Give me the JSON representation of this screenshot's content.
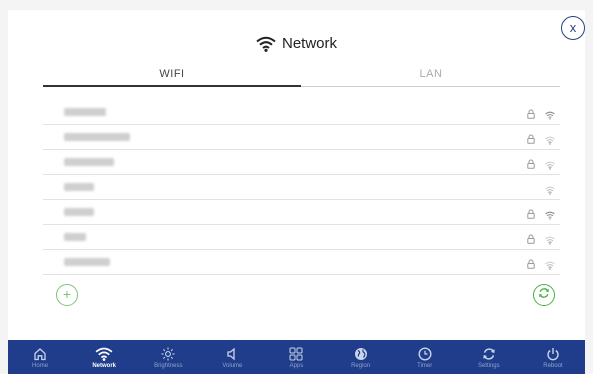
{
  "header": {
    "title": "Network",
    "close_label": "x"
  },
  "tabs": [
    {
      "label": "WIFI",
      "active": true
    },
    {
      "label": "LAN",
      "active": false
    }
  ],
  "networks": [
    {
      "ssid_redacted": true,
      "secured": true,
      "signal": "strong"
    },
    {
      "ssid_redacted": true,
      "secured": true,
      "signal": "weak"
    },
    {
      "ssid_redacted": true,
      "secured": true,
      "signal": "weak"
    },
    {
      "ssid_redacted": true,
      "secured": false,
      "signal": "weak"
    },
    {
      "ssid_redacted": true,
      "secured": true,
      "signal": "strong"
    },
    {
      "ssid_redacted": true,
      "secured": true,
      "signal": "weak"
    },
    {
      "ssid_redacted": true,
      "secured": true,
      "signal": "weak"
    }
  ],
  "actions": {
    "add_label": "+"
  },
  "nav": [
    {
      "label": "Home",
      "icon": "home-icon",
      "active": false
    },
    {
      "label": "Network",
      "icon": "wifi-icon",
      "active": true
    },
    {
      "label": "Brightness",
      "icon": "sun-icon",
      "active": false
    },
    {
      "label": "Volume",
      "icon": "speaker-icon",
      "active": false
    },
    {
      "label": "Apps",
      "icon": "apps-grid-icon",
      "active": false
    },
    {
      "label": "Region",
      "icon": "globe-icon",
      "active": false
    },
    {
      "label": "Timer",
      "icon": "clock-icon",
      "active": false
    },
    {
      "label": "Settings",
      "icon": "refresh-icon",
      "active": false
    },
    {
      "label": "Reboot",
      "icon": "power-icon",
      "active": false
    }
  ],
  "colors": {
    "nav_bg": "#1f3d8a",
    "accent_green": "#4cae4a",
    "close_blue": "#2a3f7e"
  }
}
